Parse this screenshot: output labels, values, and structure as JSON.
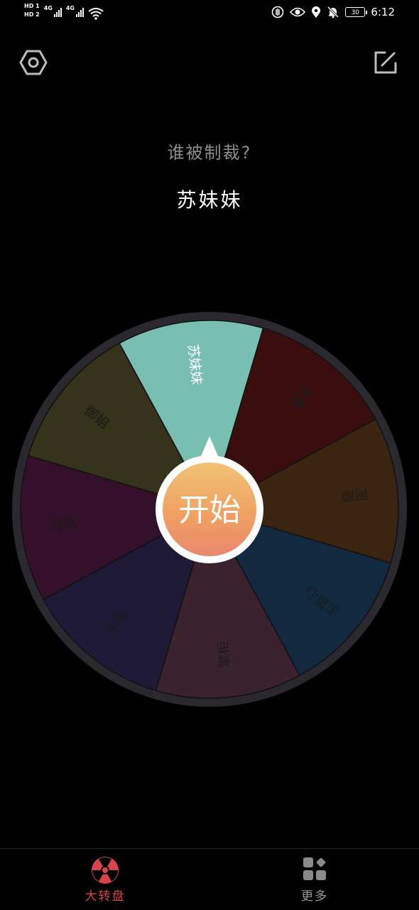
{
  "status_bar": {
    "sim1": "HD 1",
    "sim2": "HD 2",
    "net1": "4G",
    "net2": "4G",
    "battery": "30",
    "time": "6:12"
  },
  "header": {
    "settings_icon": "hexagon-gear-icon",
    "edit_icon": "edit-icon"
  },
  "question": "谁被制裁?",
  "result": "苏妹妹",
  "wheel": {
    "start_label": "开始",
    "rim_color": "#2b282f",
    "segments": [
      {
        "label": "苏妹妹",
        "color": "#78bfb1",
        "text_color": "#ffffff"
      },
      {
        "label": "老曹",
        "color": "#3a0e0e",
        "text_color": "#1a1a1a"
      },
      {
        "label": "阿顺",
        "color": "#3b2410",
        "text_color": "#1a1a1a"
      },
      {
        "label": "主旨心",
        "color": "#122a3f",
        "text_color": "#1a1a1a"
      },
      {
        "label": "掌柜",
        "color": "#3a232f",
        "text_color": "#1a1a1a"
      },
      {
        "label": "中华",
        "color": "#1f1a38",
        "text_color": "#1a1a1a"
      },
      {
        "label": "连胜",
        "color": "#34102a",
        "text_color": "#1a1a1a"
      },
      {
        "label": "御姐",
        "color": "#35331b",
        "text_color": "#1a1a1a"
      }
    ]
  },
  "tabs": [
    {
      "label": "大转盘",
      "icon": "radiation-wheel-icon",
      "active": true,
      "color": "#d9434e"
    },
    {
      "label": "更多",
      "icon": "grid-icon",
      "active": false,
      "color": "#9a9a9a"
    }
  ]
}
